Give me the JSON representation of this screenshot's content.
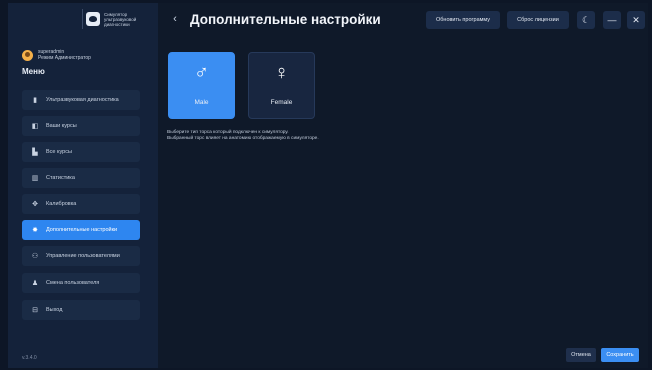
{
  "sidebar": {
    "logo_text": "Симулятор ультразвуковой диагностики",
    "user": {
      "name": "superadmin",
      "role": "Режим Администратор"
    },
    "menu_title": "Меню",
    "items": [
      {
        "label": "Ультразвуковая диагностика",
        "icon": "ultrasound-icon",
        "glyph": "▮"
      },
      {
        "label": "Ваши курсы",
        "icon": "book-icon",
        "glyph": "◧"
      },
      {
        "label": "Все курсы",
        "icon": "courses-icon",
        "glyph": "▙"
      },
      {
        "label": "Статистика",
        "icon": "chart-icon",
        "glyph": "▥"
      },
      {
        "label": "Калибровка",
        "icon": "calibration-icon",
        "glyph": "✥"
      },
      {
        "label": "Дополнительные настройки",
        "icon": "gear-icon",
        "glyph": "✸",
        "active": true
      },
      {
        "label": "Управление пользователями",
        "icon": "users-icon",
        "glyph": "⚇"
      },
      {
        "label": "Смена пользователя",
        "icon": "user-icon",
        "glyph": "♟"
      },
      {
        "label": "Выход",
        "icon": "exit-icon",
        "glyph": "⊟"
      }
    ],
    "version": "v.3.4.0"
  },
  "header": {
    "back_glyph": "‹",
    "title": "Дополнительные настройки",
    "update_button": "Обновить программу",
    "reset_license_button": "Сброс лицензии",
    "theme_glyph": "☾",
    "minimize_glyph": "—",
    "close_glyph": "✕"
  },
  "torso": {
    "options": [
      {
        "label": "Male",
        "glyph": "♂",
        "selected": true
      },
      {
        "label": "Female",
        "glyph": "♀",
        "selected": false
      }
    ],
    "hint_line1": "Выберите тип торса который подключен к симулятору.",
    "hint_line2": "Выбранный торс влияет на анатомию отображаемую в симуляторе."
  },
  "footer": {
    "cancel_label": "Отмена",
    "save_label": "Сохранить"
  },
  "colors": {
    "background": "#0f1929",
    "sidebar": "#14223a",
    "accent": "#3b8ef2"
  }
}
